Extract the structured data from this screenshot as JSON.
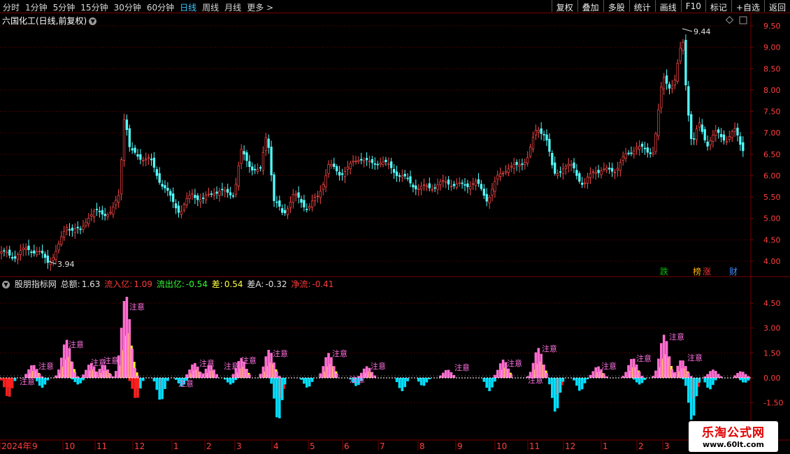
{
  "toolbar": {
    "periods": [
      "分时",
      "1分钟",
      "5分钟",
      "15分钟",
      "30分钟",
      "60分钟",
      "日线",
      "周线",
      "月线",
      "更多 >"
    ],
    "active_period": "日线",
    "right_buttons": [
      "复权",
      "叠加",
      "多股",
      "统计",
      "画线",
      "F10",
      "标记",
      "+自选",
      "返回"
    ]
  },
  "main_panel": {
    "title": "六国化工(日线,前复权)",
    "high_label": "9.44",
    "low_label": "3.94",
    "price_ticks": [
      "9.50",
      "9.00",
      "8.50",
      "8.00",
      "7.50",
      "7.00",
      "6.50",
      "6.00",
      "5.50",
      "5.00",
      "4.50",
      "4.00"
    ],
    "event_markers": [
      {
        "text": "跌",
        "color": "#00c000"
      },
      {
        "text": "榜",
        "color": "#ffb400"
      },
      {
        "text": "涨",
        "color": "#ff3030"
      },
      {
        "text": "财",
        "color": "#3c8cff"
      }
    ]
  },
  "indicator_panel": {
    "name": "股朋指标网",
    "total_label": "总额:",
    "total_value": "1.63",
    "inflow_label": "流入亿:",
    "inflow_value": "1.09",
    "outflow_label": "流出亿:",
    "outflow_value": "-0.54",
    "diff_label": "差:",
    "diff_value": "0.54",
    "diffA_label": "差A:",
    "diffA_value": "-0.32",
    "net_label": "净流:",
    "net_value": "-0.41",
    "ticks": [
      "4.50",
      "3.00",
      "1.50",
      "0.00",
      "-1.50"
    ],
    "annotation": "注意"
  },
  "time_axis": {
    "labels": [
      "2024年",
      "9",
      "10",
      "11",
      "12",
      "1",
      "2",
      "3",
      "4",
      "5",
      "6",
      "7",
      "8",
      "9",
      "10",
      "11",
      "12",
      "1",
      "2",
      "3"
    ]
  },
  "watermark": {
    "line1": "乐淘公式网",
    "line2": "www.60lt.com"
  },
  "colors": {
    "up": "#ff4a4a",
    "down": "#54ffff",
    "grid": "#7a0000",
    "pink": "#ff6ed0",
    "yellow": "#ffff00",
    "cyan": "#00e0ff",
    "red": "#ff2020"
  }
}
